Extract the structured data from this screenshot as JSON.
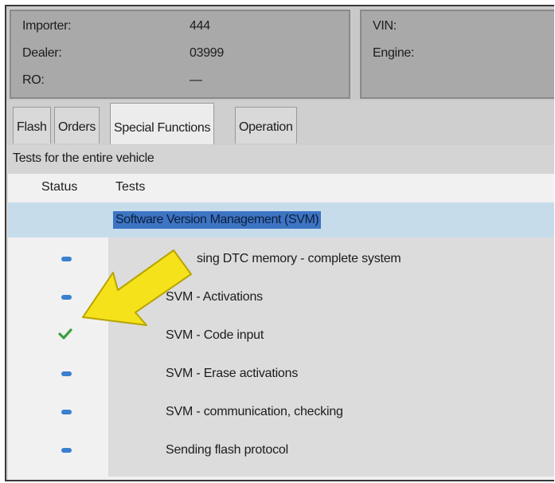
{
  "header": {
    "importer_label": "Importer:",
    "importer_value": "444",
    "dealer_label": "Dealer:",
    "dealer_value": "03999",
    "ro_label": "RO:",
    "ro_value": "—",
    "vin_label": "VIN:",
    "engine_label": "Engine:"
  },
  "tabs": [
    {
      "label": "Flash"
    },
    {
      "label": "Orders"
    },
    {
      "label": "Special Functions",
      "active": true
    },
    {
      "label": "Operation"
    }
  ],
  "section_title": "Tests for the entire vehicle",
  "columns": {
    "status": "Status",
    "tests": "Tests"
  },
  "selected_item": "Software Version Management (SVM)",
  "tests": [
    {
      "status": "dash-icon",
      "label": "sing DTC memory - complete system"
    },
    {
      "status": "dash-icon",
      "label": "SVM - Activations"
    },
    {
      "status": "check-icon",
      "label": "SVM - Code input"
    },
    {
      "status": "dash-icon",
      "label": "SVM - Erase activations"
    },
    {
      "status": "dash-icon",
      "label": "SVM - communication, checking"
    },
    {
      "status": "dash-icon",
      "label": "Sending flash protocol"
    }
  ],
  "colors": {
    "status_dash": "#3a7fd0",
    "status_check": "#3aa040",
    "selection": "#3d74c4",
    "arrow": "#f5e21a"
  }
}
